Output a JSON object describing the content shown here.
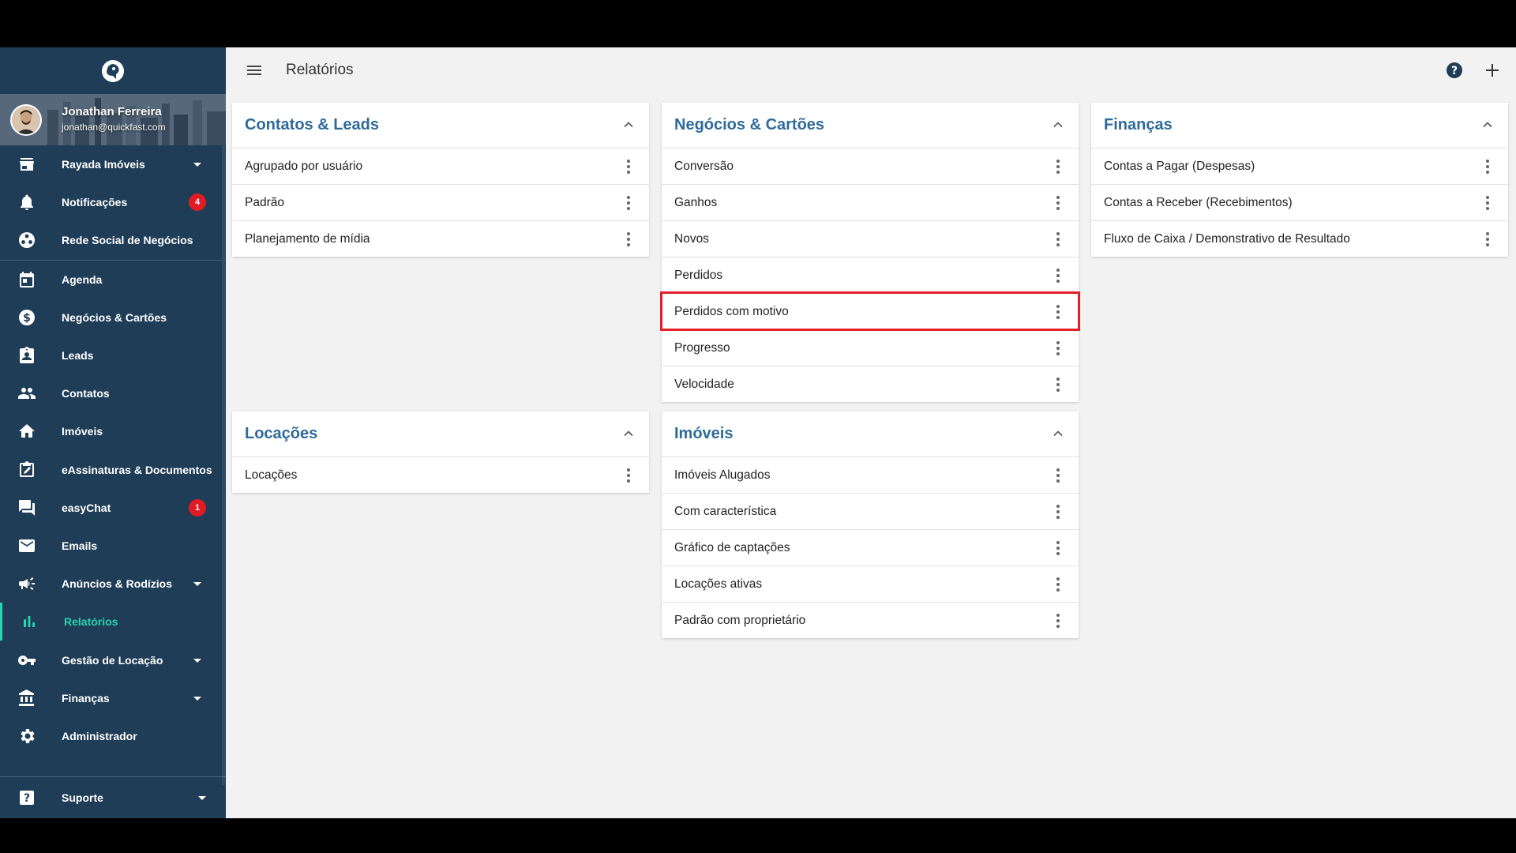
{
  "user": {
    "name": "Jonathan Ferreira",
    "email": "jonathan@quickfast.com"
  },
  "header": {
    "title": "Relatórios"
  },
  "sidebar": {
    "items": [
      {
        "label": "Rayada Imóveis",
        "icon": "store-icon",
        "caret": true
      },
      {
        "label": "Notificações",
        "icon": "bell-icon",
        "badge": "4"
      },
      {
        "label": "Rede Social de Negócios",
        "icon": "network-icon"
      },
      {
        "label": "Agenda",
        "icon": "calendar-icon"
      },
      {
        "label": "Negócios & Cartões",
        "icon": "dollar-icon"
      },
      {
        "label": "Leads",
        "icon": "badge-icon"
      },
      {
        "label": "Contatos",
        "icon": "people-icon"
      },
      {
        "label": "Imóveis",
        "icon": "home-icon"
      },
      {
        "label": "eAssinaturas & Documentos",
        "icon": "signature-icon"
      },
      {
        "label": "easyChat",
        "icon": "chat-icon",
        "badge": "1"
      },
      {
        "label": "Emails",
        "icon": "mail-icon"
      },
      {
        "label": "Anúncios & Rodízios",
        "icon": "megaphone-icon",
        "caret": true
      },
      {
        "label": "Relatórios",
        "icon": "bar-chart-icon",
        "active": true
      },
      {
        "label": "Gestão de Locação",
        "icon": "key-icon",
        "caret": true
      },
      {
        "label": "Finanças",
        "icon": "bank-icon",
        "caret": true
      },
      {
        "label": "Administrador",
        "icon": "gear-icon"
      }
    ],
    "support": {
      "label": "Suporte",
      "icon": "help-box-icon"
    }
  },
  "cards": {
    "contatos": {
      "title": "Contatos & Leads",
      "rows": [
        "Agrupado por usuário",
        "Padrão",
        "Planejamento de mídia"
      ]
    },
    "negocios": {
      "title": "Negócios & Cartões",
      "rows": [
        "Conversão",
        "Ganhos",
        "Novos",
        "Perdidos",
        "Perdidos com motivo",
        "Progresso",
        "Velocidade"
      ]
    },
    "financas": {
      "title": "Finanças",
      "rows": [
        "Contas a Pagar (Despesas)",
        "Contas a Receber (Recebimentos)",
        "Fluxo de Caixa / Demonstrativo de Resultado"
      ]
    },
    "locacoes": {
      "title": "Locações",
      "rows": [
        "Locações"
      ]
    },
    "imoveis": {
      "title": "Imóveis",
      "rows": [
        "Imóveis Alugados",
        "Com característica",
        "Gráfico de captações",
        "Locações ativas",
        "Padrão com proprietário"
      ]
    }
  },
  "colors": {
    "sidebar_bg": "#1f3d57",
    "accent": "#2ad3b4",
    "card_title": "#2e6b9a",
    "badge": "#e01b24",
    "highlight": "#e32028"
  }
}
